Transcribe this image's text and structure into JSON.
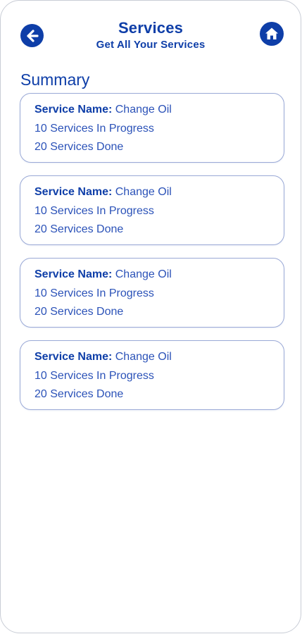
{
  "header": {
    "title": "Services",
    "subtitle": "Get All Your Services",
    "back_icon": "arrow-left-circle-icon",
    "home_icon": "home-icon"
  },
  "summary": {
    "heading": "Summary",
    "cards": [
      {
        "service_label": "Service Name:",
        "service_name": "Change Oil",
        "in_progress": "10 Services In Progress",
        "done": "20 Services Done"
      },
      {
        "service_label": "Service Name:",
        "service_name": "Change Oil",
        "in_progress": "10 Services In Progress",
        "done": "20 Services Done"
      },
      {
        "service_label": "Service Name:",
        "service_name": "Change Oil",
        "in_progress": "10 Services In Progress",
        "done": "20 Services Done"
      },
      {
        "service_label": "Service Name:",
        "service_name": "Change Oil",
        "in_progress": "10 Services In Progress",
        "done": "20 Services Done"
      }
    ]
  },
  "colors": {
    "primary": "#0e3ea8",
    "text_secondary": "#2b52b8",
    "card_border": "#9aa9d6"
  }
}
